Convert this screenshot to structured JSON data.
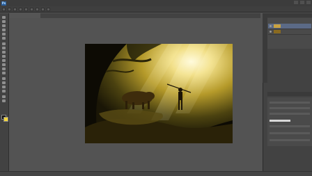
{
  "app": {
    "logo": "Ps"
  },
  "menu": {
    "items": [
      "",
      "",
      "",
      "",
      "",
      "",
      "",
      "",
      "",
      "",
      ""
    ]
  },
  "document": {
    "tab_label": "",
    "status": ""
  },
  "colors": {
    "foreground": "#111111",
    "background": "#f2d53c",
    "workspace": "#535353",
    "panel": "#424242"
  },
  "icons": [
    "move-tool-icon",
    "marquee-tool-icon",
    "lasso-tool-icon",
    "quick-select-tool-icon",
    "crop-tool-icon",
    "eyedropper-tool-icon",
    "healing-brush-icon",
    "brush-tool-icon",
    "clone-stamp-icon",
    "history-brush-icon",
    "eraser-tool-icon",
    "gradient-tool-icon",
    "blur-tool-icon",
    "dodge-tool-icon",
    "pen-tool-icon",
    "type-tool-icon",
    "path-select-icon",
    "shape-tool-icon",
    "hand-tool-icon",
    "zoom-tool-icon"
  ]
}
